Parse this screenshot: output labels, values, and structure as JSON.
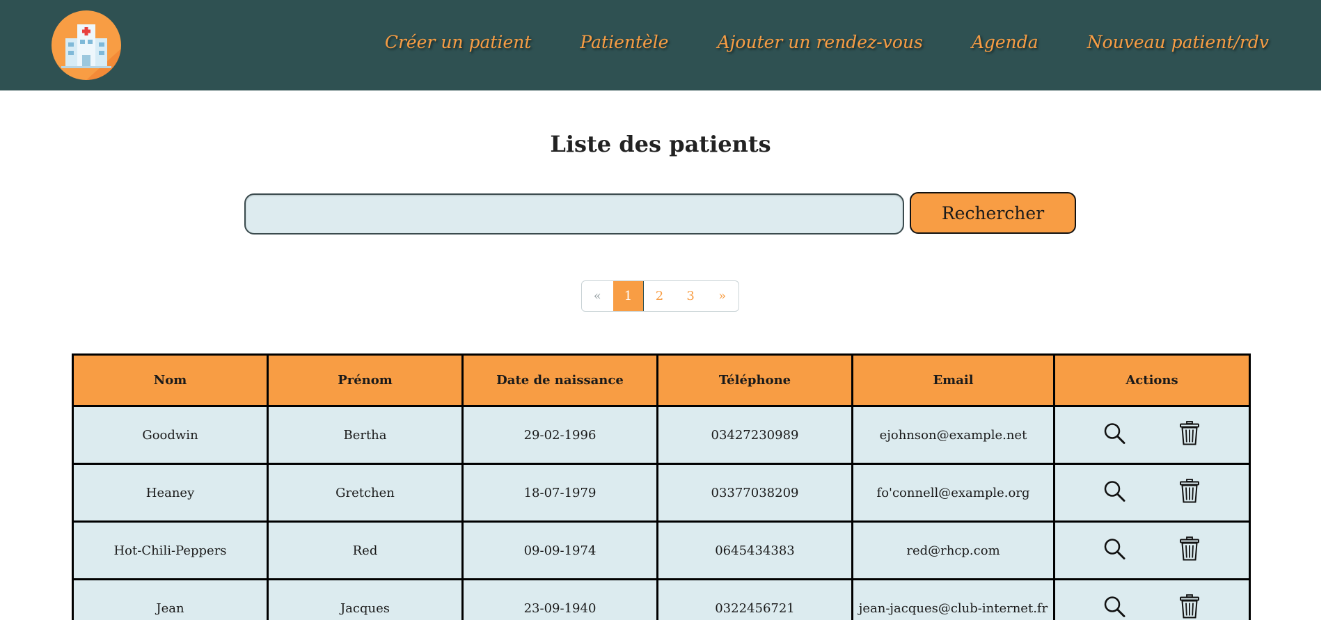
{
  "nav": {
    "logo_icon": "hospital-icon",
    "links": [
      "Créer un patient",
      "Patientèle",
      "Ajouter un rendez-vous",
      "Agenda",
      "Nouveau patient/rdv"
    ]
  },
  "page": {
    "title": "Liste des patients"
  },
  "search": {
    "value": "",
    "placeholder": "",
    "button_label": "Rechercher"
  },
  "pagination": {
    "prev": "«",
    "pages": [
      "1",
      "2",
      "3"
    ],
    "next": "»",
    "current": "1"
  },
  "table": {
    "headers": [
      "Nom",
      "Prénom",
      "Date de naissance",
      "Téléphone",
      "Email",
      "Actions"
    ],
    "rows": [
      {
        "nom": "Goodwin",
        "prenom": "Bertha",
        "naissance": "29-02-1996",
        "telephone": "03427230989",
        "email": "ejohnson@example.net"
      },
      {
        "nom": "Heaney",
        "prenom": "Gretchen",
        "naissance": "18-07-1979",
        "telephone": "03377038209",
        "email": "fo'connell@example.org"
      },
      {
        "nom": "Hot-Chili-Peppers",
        "prenom": "Red",
        "naissance": "09-09-1974",
        "telephone": "0645434383",
        "email": "red@rhcp.com"
      },
      {
        "nom": "Jean",
        "prenom": "Jacques",
        "naissance": "23-09-1940",
        "telephone": "0322456721",
        "email": "jean-jacques@club-internet.fr"
      }
    ],
    "action_icons": [
      "magnifier-icon",
      "trash-icon"
    ]
  },
  "colors": {
    "navbar": "#2f5152",
    "accent": "#f89d44",
    "row_bg": "#dcebef"
  }
}
